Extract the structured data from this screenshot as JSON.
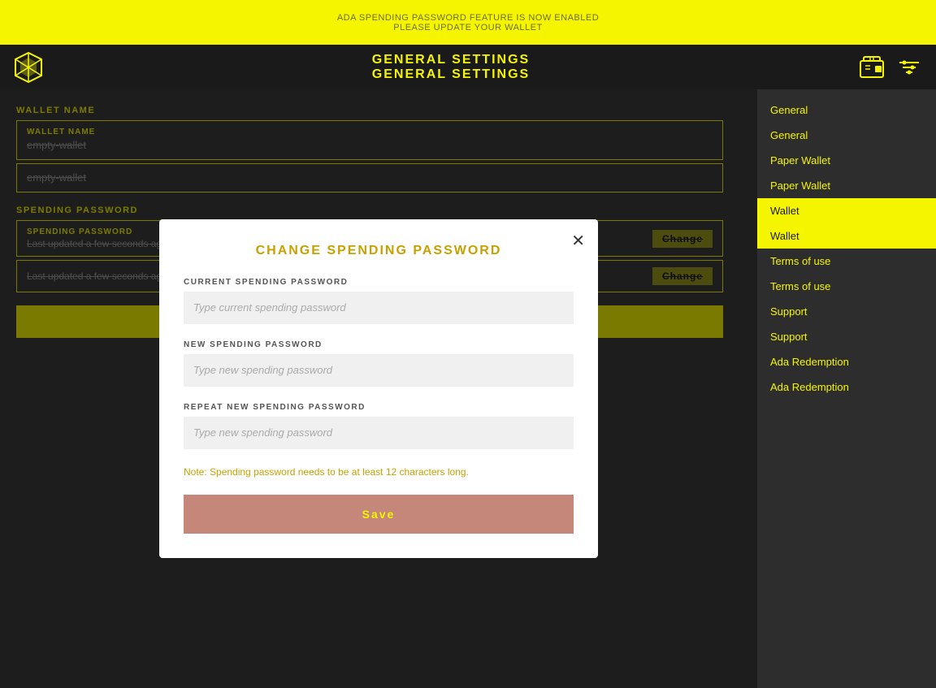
{
  "topBanner": {
    "line1": "ADA SPENDING PASSWORD FEATURE IS NOW ENABLED",
    "line2": "PLEASE UPDATE YOUR WALLET"
  },
  "header": {
    "title1": "GENERAL SETTINGS",
    "title2": "GENERAL SETTINGS",
    "walletIcon": "wallet-icon",
    "filterIcon": "filter-icon"
  },
  "walletSection": {
    "walletNameLabel": "WALLET NAME",
    "walletNameFieldLabel": "WALLET NAME",
    "walletNameValue": "empty-wallet",
    "walletNameValue2": "empty-wallet",
    "spendingPasswordLabel": "SPENDING PASSWORD",
    "spendingPasswordFieldLabel": "SPENDING PASSWORD",
    "spendingPasswordStatus1": "Last updated a few seconds ago",
    "spendingPasswordStatus2": "Last updated a few seconds ago",
    "changeButton": "Change",
    "saveButton": "Save"
  },
  "sidebar": {
    "items": [
      {
        "id": "general1",
        "label": "General",
        "active": false
      },
      {
        "id": "general2",
        "label": "General",
        "active": false
      },
      {
        "id": "paperWallet1",
        "label": "Paper Wallet",
        "active": false
      },
      {
        "id": "paperWallet2",
        "label": "Paper Wallet",
        "active": false
      },
      {
        "id": "wallet1",
        "label": "Wallet",
        "active": true
      },
      {
        "id": "wallet2",
        "label": "Wallet",
        "active": true
      },
      {
        "id": "termsOfUse1",
        "label": "Terms of use",
        "active": false
      },
      {
        "id": "termsOfUse2",
        "label": "Terms of use",
        "active": false
      },
      {
        "id": "support1",
        "label": "Support",
        "active": false
      },
      {
        "id": "support2",
        "label": "Support",
        "active": false
      },
      {
        "id": "adaRedemption1",
        "label": "Ada Redemption",
        "active": false
      },
      {
        "id": "adaRedemption2",
        "label": "Ada Redemption",
        "active": false
      }
    ]
  },
  "modal": {
    "title": "CHANGE SPENDING PASSWORD",
    "currentPasswordLabel": "CURRENT SPENDING PASSWORD",
    "currentPasswordPlaceholder": "Type current spending password",
    "newPasswordLabel": "NEW SPENDING PASSWORD",
    "newPasswordPlaceholder": "Type new spending password",
    "repeatPasswordLabel": "REPEAT NEW SPENDING PASSWORD",
    "repeatPasswordPlaceholder": "Type new spending password",
    "note": "Note: Spending password needs to be at least 12 characters long.",
    "saveButton": "Save"
  }
}
